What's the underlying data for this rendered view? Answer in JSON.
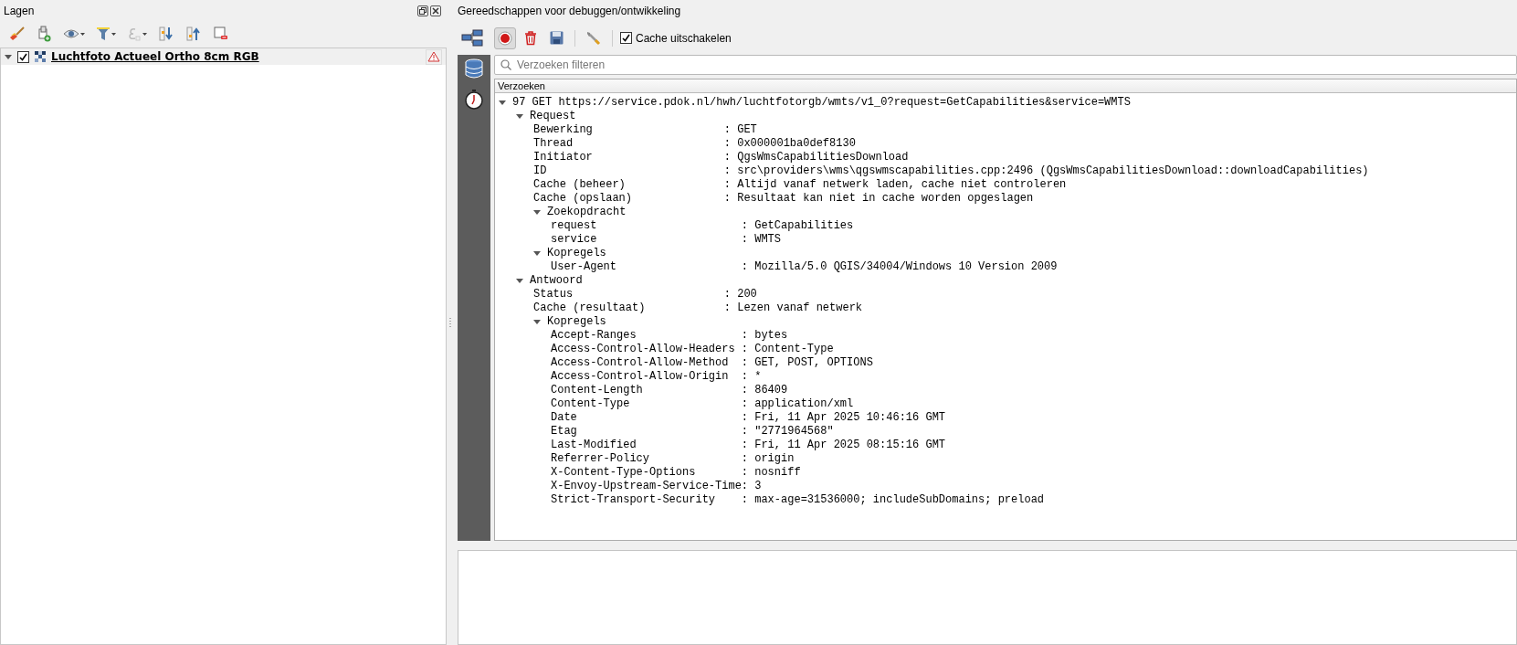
{
  "layers_panel": {
    "title": "Lagen",
    "layers": [
      {
        "name": "Luchtfoto Actueel Ortho 8cm RGB",
        "checked": true,
        "expanded": true,
        "warning": true
      }
    ]
  },
  "dev_panel": {
    "title": "Gereedschappen voor debuggen/ontwikkeling",
    "record_button": {
      "pressed": true
    },
    "cache_checkbox": {
      "label": "Cache uitschakelen",
      "checked": true
    },
    "filter": {
      "placeholder": "Verzoeken filteren"
    },
    "requests": {
      "header": "Verzoeken",
      "separator": ":",
      "tree": [
        {
          "label": "97 GET https://service.pdok.nl/hwh/luchtfotorgb/wmts/v1_0?request=GetCapabilities&service=WMTS",
          "expanded": true,
          "children": [
            {
              "label": "Request",
              "expanded": true,
              "children": [
                {
                  "key": "Bewerking",
                  "value": "GET"
                },
                {
                  "key": "Thread",
                  "value": "0x000001ba0def8130"
                },
                {
                  "key": "Initiator",
                  "value": "QgsWmsCapabilitiesDownload"
                },
                {
                  "key": "ID",
                  "value": "src\\providers\\wms\\qgswmscapabilities.cpp:2496 (QgsWmsCapabilitiesDownload::downloadCapabilities)"
                },
                {
                  "key": "Cache (beheer)",
                  "value": "Altijd vanaf netwerk laden, cache niet controleren"
                },
                {
                  "key": "Cache (opslaan)",
                  "value": "Resultaat kan niet in cache worden opgeslagen"
                },
                {
                  "label": "Zoekopdracht",
                  "expanded": true,
                  "children": [
                    {
                      "key": "request",
                      "value": "GetCapabilities"
                    },
                    {
                      "key": "service",
                      "value": "WMTS"
                    }
                  ]
                },
                {
                  "label": "Kopregels",
                  "expanded": true,
                  "children": [
                    {
                      "key": "User-Agent",
                      "value": "Mozilla/5.0 QGIS/34004/Windows 10 Version 2009"
                    }
                  ]
                }
              ]
            },
            {
              "label": "Antwoord",
              "expanded": true,
              "children": [
                {
                  "key": "Status",
                  "value": "200"
                },
                {
                  "key": "Cache (resultaat)",
                  "value": "Lezen vanaf netwerk"
                },
                {
                  "label": "Kopregels",
                  "expanded": true,
                  "children": [
                    {
                      "key": "Accept-Ranges",
                      "value": "bytes"
                    },
                    {
                      "key": "Access-Control-Allow-Headers",
                      "value": "Content-Type"
                    },
                    {
                      "key": "Access-Control-Allow-Method",
                      "value": "GET, POST, OPTIONS"
                    },
                    {
                      "key": "Access-Control-Allow-Origin",
                      "value": "*"
                    },
                    {
                      "key": "Content-Length",
                      "value": "86409"
                    },
                    {
                      "key": "Content-Type",
                      "value": "application/xml"
                    },
                    {
                      "key": "Date",
                      "value": "Fri, 11 Apr 2025 10:46:16 GMT"
                    },
                    {
                      "key": "Etag",
                      "value": "\"2771964568\""
                    },
                    {
                      "key": "Last-Modified",
                      "value": "Fri, 11 Apr 2025 08:15:16 GMT"
                    },
                    {
                      "key": "Referrer-Policy",
                      "value": "origin"
                    },
                    {
                      "key": "X-Content-Type-Options",
                      "value": "nosniff"
                    },
                    {
                      "key": "X-Envoy-Upstream-Service-Time",
                      "value": "3"
                    },
                    {
                      "key": "Strict-Transport-Security",
                      "value": "max-age=31536000; includeSubDomains; preload"
                    }
                  ]
                }
              ]
            }
          ]
        }
      ]
    }
  }
}
